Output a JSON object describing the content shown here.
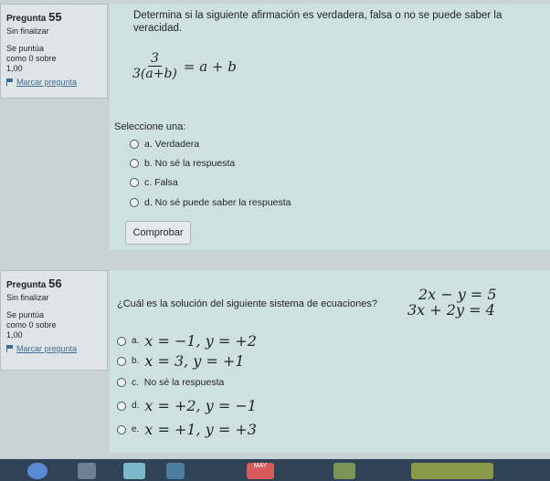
{
  "q55": {
    "label": "Pregunta",
    "number": "55",
    "status": "Sin finalizar",
    "score_label": "Se puntúa",
    "score_line": "como 0 sobre",
    "score_max": "1,00",
    "flag": "Marcar pregunta",
    "stem": "Determina si la siguiente afirmación es verdadera, falsa o no se puede saber la veracidad.",
    "expr_num": "3",
    "expr_den": "3(a+b)",
    "expr_rhs": "= a + b",
    "select_label": "Seleccione una:",
    "options": [
      "a.  Verdadera",
      "b.  No sé la respuesta",
      "c.  Falsa",
      "d.  No sé puede saber la respuesta"
    ],
    "button": "Comprobar"
  },
  "q56": {
    "label": "Pregunta",
    "number": "56",
    "status": "Sin finalizar",
    "score_label": "Se puntúa",
    "score_line": "como 0 sobre",
    "score_max": "1,00",
    "flag": "Marcar pregunta",
    "stem": "¿Cuál es la solución del siguiente sistema de ecuaciones?",
    "eq1": "2x − y = 5",
    "eq2": "3x + 2y = 4",
    "options": [
      {
        "letter": "a.",
        "text": "x = −1, y = +2"
      },
      {
        "letter": "b.",
        "text": "x = 3, y = +1"
      },
      {
        "letter": "c.",
        "text": "No sé la respuesta"
      },
      {
        "letter": "d.",
        "text": "x = +2, y = −1"
      },
      {
        "letter": "e.",
        "text": "x = +1, y = +3"
      }
    ]
  },
  "taskbar": {
    "icons": [
      "rocket-icon",
      "pencil-icon",
      "book-icon",
      "calendar-icon",
      "grid-icon"
    ],
    "calendar_month": "MAY"
  }
}
